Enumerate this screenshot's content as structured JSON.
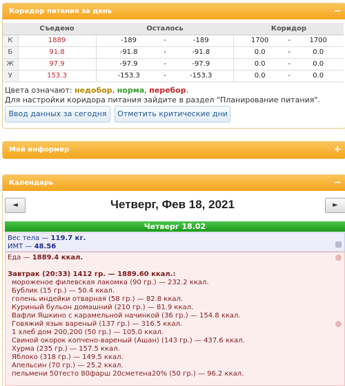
{
  "corridor": {
    "title": "Коридор питания за день",
    "headers": [
      "Съедено",
      "Осталось",
      "Коридор"
    ],
    "rows": [
      {
        "label": "К",
        "eaten": "1889",
        "left_a": "-189",
        "dash1": "-",
        "left_b": "-189",
        "corr_a": "1700",
        "dash2": "-",
        "corr_b": "1700"
      },
      {
        "label": "Б",
        "eaten": "91.8",
        "left_a": "-91.8",
        "dash1": "-",
        "left_b": "-91.8",
        "corr_a": "0.0",
        "dash2": "-",
        "corr_b": "0.0"
      },
      {
        "label": "Ж",
        "eaten": "97.9",
        "left_a": "-97.9",
        "dash1": "-",
        "left_b": "-97.9",
        "corr_a": "0.0",
        "dash2": "-",
        "corr_b": "0.0"
      },
      {
        "label": "У",
        "eaten": "153.3",
        "left_a": "-153.3",
        "dash1": "-",
        "left_b": "-153.3",
        "corr_a": "0.0",
        "dash2": "-",
        "corr_b": "0.0"
      }
    ],
    "legend_prefix": "Цвета означают: ",
    "legend_under": "недобор",
    "legend_sep1": ", ",
    "legend_norm": "норма",
    "legend_sep2": ", ",
    "legend_over": "перебор",
    "legend_end": ".",
    "note": "Для настройки коридора питания зайдите в раздел \"Планирование питания\".",
    "btn_today": "Ввод данных за сегодня",
    "btn_critical": "Отметить критические дни",
    "collapse_icon": "minus-icon"
  },
  "informer": {
    "title": "Мой информер",
    "expand_icon": "plus-icon"
  },
  "calendar": {
    "title": "Календарь",
    "prev": "◄",
    "next": "►",
    "date": "Четверг, Фев 18, 2021",
    "day_header": "Четверг 18.02",
    "weight_label": "Вес тела — ",
    "weight_value": "119.7 кг.",
    "bmi_label": "ИМТ — ",
    "bmi_value": "48.56",
    "food_label": "Еда — ",
    "food_value": "1889.4 ккал.",
    "meal_title": "Завтрак (20:33) 1412 гр. — 1889.60 ккал.:",
    "items": [
      "мороженое филевская лакомка (90 гр.) — 232.2 ккал.",
      "Бублик (15 гр.) — 50.4 ккал.",
      "голень индейки отварная (58 гр.) — 82.8 ккал.",
      "Куриный бульон домашний (210 гр.) — 81.9 ккал.",
      "Вафли Яшкино с карамельной начинкой (36 гр.) — 154.8 ккал.",
      "Говяжий язык вареный (137 гр.) — 316.5 ккал.",
      "1 хлеб дом 200,200 (50 гр.) — 105.0 ккал.",
      "Свиной окорок копчено-вареный (Ашан) (143 гр.) — 437.6 ккал.",
      "Хурма (235 гр.) — 157.5 ккал.",
      "Яблоко (318 гр.) — 149.5 ккал.",
      "Апельсин (70 гр.) — 25.2 ккал.",
      "пельмени 50тесто 80фарш 20сметена20% (50 гр.) — 96.2 ккал."
    ]
  }
}
